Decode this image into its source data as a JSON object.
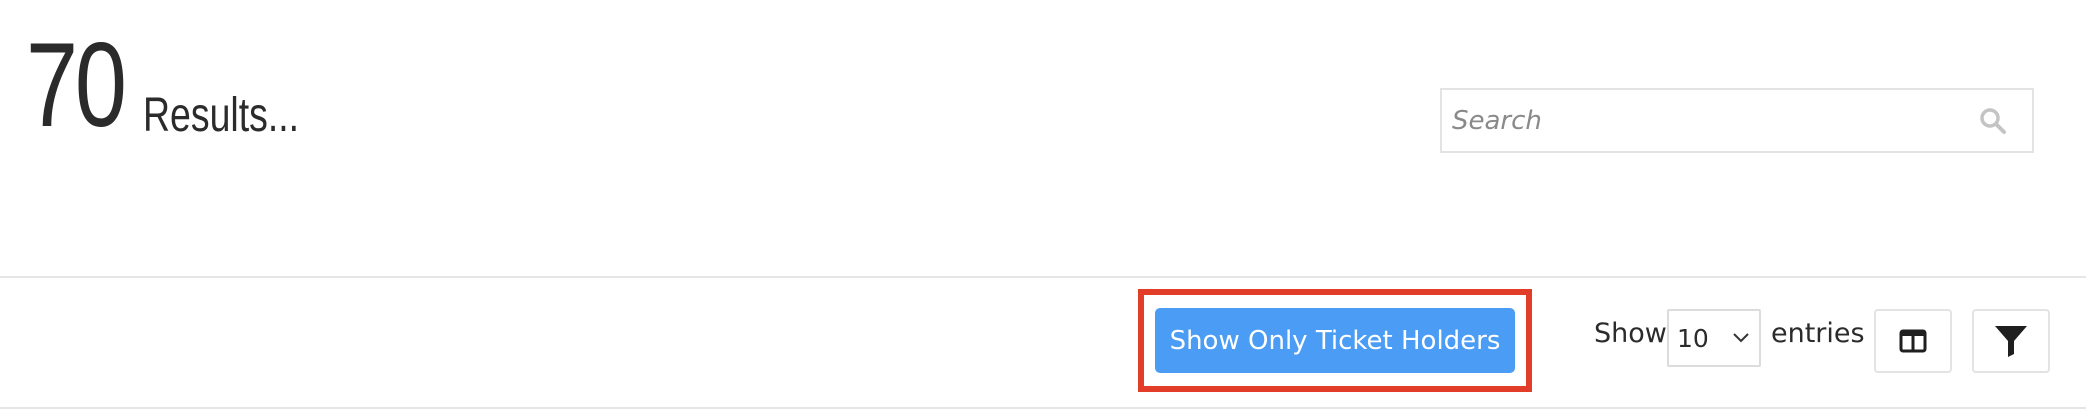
{
  "results": {
    "count": "70",
    "label": "Results..."
  },
  "search": {
    "placeholder": "Search",
    "value": ""
  },
  "toolbar": {
    "ticket_button_label": "Show Only Ticket Holders",
    "show_label": "Show",
    "entries_value": "10",
    "entries_label": "entries"
  },
  "colors": {
    "accent": "#4a9cf5",
    "highlight": "#e23d28"
  },
  "icons": [
    "search-icon",
    "chevron-down-icon",
    "columns-icon",
    "filter-icon"
  ]
}
